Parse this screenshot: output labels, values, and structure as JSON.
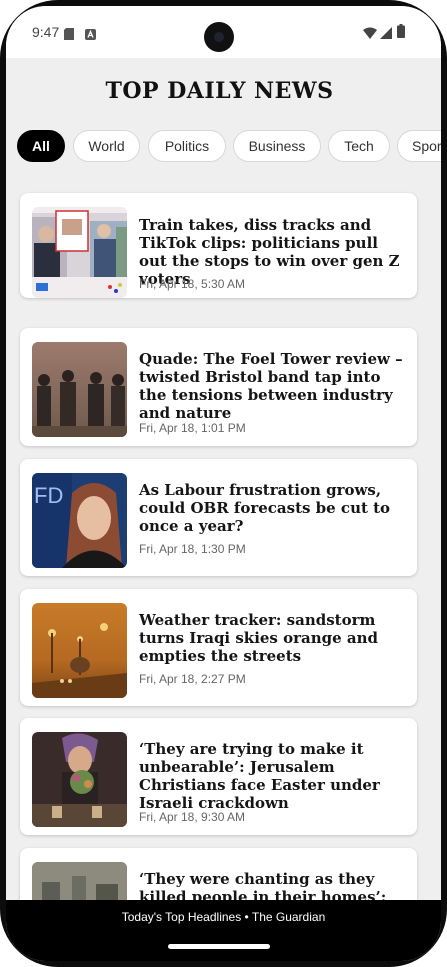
{
  "status_bar": {
    "time": "9:47"
  },
  "app": {
    "title": "TOP DAILY NEWS"
  },
  "categories": [
    {
      "label": "All",
      "selected": true
    },
    {
      "label": "World",
      "selected": false
    },
    {
      "label": "Politics",
      "selected": false
    },
    {
      "label": "Business",
      "selected": false
    },
    {
      "label": "Tech",
      "selected": false
    },
    {
      "label": "Sports",
      "selected": false
    }
  ],
  "articles": [
    {
      "headline": "Train takes, diss tracks and TikTok clips: politicians pull out the stops to win over gen Z voters",
      "date": "Fri, Apr 18, 5:30 AM"
    },
    {
      "headline": "Quade: The Foel Tower review – twisted Bristol band tap into the tensions between industry and nature",
      "date": "Fri, Apr 18, 1:01 PM"
    },
    {
      "headline": "As Labour frustration grows, could OBR forecasts be cut to once a year?",
      "date": "Fri, Apr 18, 1:30 PM"
    },
    {
      "headline": "Weather tracker: sandstorm turns Iraqi skies orange and empties the streets",
      "date": "Fri, Apr 18, 2:27 PM"
    },
    {
      "headline": "‘They are trying to make it unbearable’: Jerusalem Christians face Easter under Israeli crackdown",
      "date": "Fri, Apr 18, 9:30 AM"
    },
    {
      "headline": "‘They were chanting as they killed people in their homes’: survivors describe attack on Sudan’s",
      "date": ""
    }
  ],
  "footer": {
    "text": "Today's Top Headlines • The Guardian"
  },
  "colors": {
    "chip_active_bg": "#000000",
    "feed_bg": "#efefef",
    "bottom_bar": "#000000"
  }
}
